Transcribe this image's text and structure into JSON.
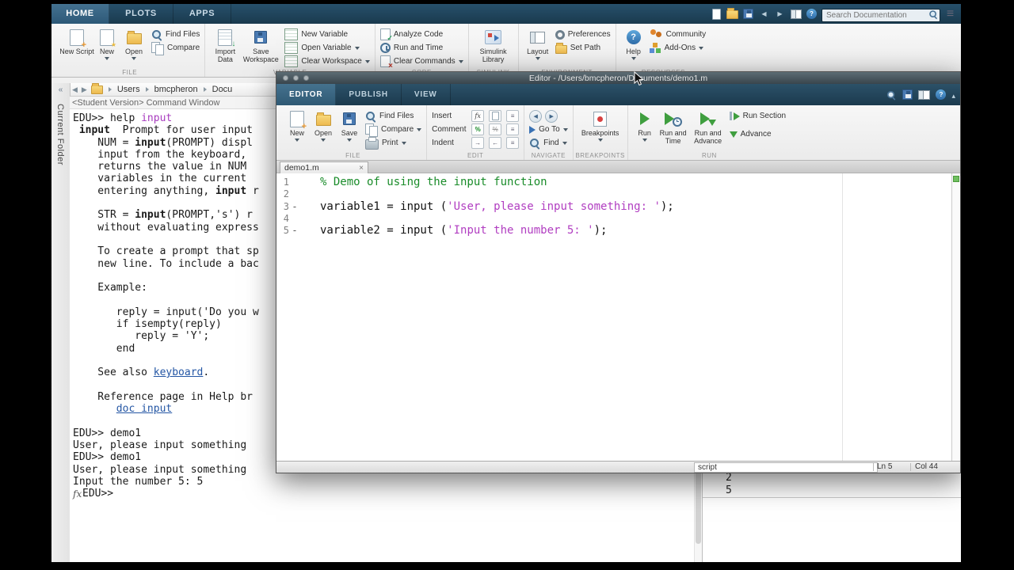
{
  "main_titlebar": {
    "tabs": [
      {
        "label": "HOME",
        "active": true
      },
      {
        "label": "PLOTS",
        "active": false
      },
      {
        "label": "APPS",
        "active": false
      }
    ],
    "search_placeholder": "Search Documentation"
  },
  "main_ribbon": {
    "new_script": "New Script",
    "new": "New",
    "open": "Open",
    "find_files": "Find Files",
    "compare": "Compare",
    "import_data": "Import Data",
    "save_workspace": "Save Workspace",
    "new_variable": "New Variable",
    "open_variable": "Open Variable",
    "clear_workspace": "Clear Workspace",
    "analyze_code": "Analyze Code",
    "run_and_time": "Run and Time",
    "clear_commands": "Clear Commands",
    "simulink_library": "Simulink Library",
    "layout": "Layout",
    "preferences": "Preferences",
    "set_path": "Set Path",
    "help": "Help",
    "community": "Community",
    "add_ons": "Add-Ons",
    "sections": {
      "file": "FILE",
      "variable": "VARIABLE",
      "code": "CODE",
      "simulink": "SIMULINK",
      "environment": "ENVIRONMENT",
      "resources": "RESOURCES"
    }
  },
  "browser_bar": {
    "path": [
      "Users",
      "bmcpheron",
      "Docu"
    ]
  },
  "sidebar": {
    "label": "Current Folder",
    "collapse_glyph": "«"
  },
  "command_window": {
    "title": "<Student Version> Command Window",
    "fx_label": "fx",
    "lines": [
      {
        "segs": [
          {
            "t": "EDU>> help "
          },
          {
            "t": "input",
            "c": "cmd"
          }
        ]
      },
      {
        "segs": [
          {
            "t": " "
          },
          {
            "t": "input",
            "c": "b"
          },
          {
            "t": "  Prompt for user input"
          }
        ]
      },
      {
        "segs": [
          {
            "t": "    NUM = "
          },
          {
            "t": "input",
            "c": "b"
          },
          {
            "t": "(PROMPT) displ"
          }
        ]
      },
      {
        "segs": [
          {
            "t": "    input from the keyboard,"
          }
        ]
      },
      {
        "segs": [
          {
            "t": "    returns the value in NUM"
          }
        ]
      },
      {
        "segs": [
          {
            "t": "    variables in the current"
          }
        ]
      },
      {
        "segs": [
          {
            "t": "    entering anything, "
          },
          {
            "t": "input",
            "c": "b"
          },
          {
            "t": " r"
          }
        ]
      },
      {
        "segs": []
      },
      {
        "segs": [
          {
            "t": "    STR = "
          },
          {
            "t": "input",
            "c": "b"
          },
          {
            "t": "(PROMPT,'s') r"
          }
        ]
      },
      {
        "segs": [
          {
            "t": "    without evaluating express"
          }
        ]
      },
      {
        "segs": []
      },
      {
        "segs": [
          {
            "t": "    To create a prompt that sp"
          }
        ]
      },
      {
        "segs": [
          {
            "t": "    new line. To include a bac"
          }
        ]
      },
      {
        "segs": []
      },
      {
        "segs": [
          {
            "t": "    Example:"
          }
        ]
      },
      {
        "segs": []
      },
      {
        "segs": [
          {
            "t": "       reply = input('Do you w"
          }
        ]
      },
      {
        "segs": [
          {
            "t": "       if isempty(reply)"
          }
        ]
      },
      {
        "segs": [
          {
            "t": "          reply = 'Y';"
          }
        ]
      },
      {
        "segs": [
          {
            "t": "       end"
          }
        ]
      },
      {
        "segs": []
      },
      {
        "segs": [
          {
            "t": "    See also "
          },
          {
            "t": "keyboard",
            "c": "link"
          },
          {
            "t": "."
          }
        ]
      },
      {
        "segs": []
      },
      {
        "segs": [
          {
            "t": "    Reference page in Help br"
          }
        ]
      },
      {
        "segs": [
          {
            "t": "       "
          },
          {
            "t": "doc input",
            "c": "link"
          }
        ]
      },
      {
        "segs": []
      },
      {
        "segs": [
          {
            "t": "EDU>> demo1"
          }
        ]
      },
      {
        "segs": [
          {
            "t": "User, please input something"
          }
        ]
      },
      {
        "segs": [
          {
            "t": "EDU>> demo1"
          }
        ]
      },
      {
        "segs": [
          {
            "t": "User, please input something"
          }
        ]
      },
      {
        "segs": [
          {
            "t": "Input the number 5: 5"
          }
        ]
      },
      {
        "fx": true,
        "segs": [
          {
            "t": "EDU>> "
          }
        ]
      }
    ]
  },
  "background_panel": {
    "lines": [
      "2",
      "5"
    ]
  },
  "editor": {
    "window_title": "Editor - /Users/bmcpheron/Documents/demo1.m",
    "tabs": [
      {
        "label": "EDITOR",
        "active": true
      },
      {
        "label": "PUBLISH",
        "active": false
      },
      {
        "label": "VIEW",
        "active": false
      }
    ],
    "ribbon": {
      "file": {
        "new": "New",
        "open": "Open",
        "save": "Save",
        "find_files": "Find Files",
        "compare": "Compare",
        "print": "Print"
      },
      "edit": {
        "insert": "Insert",
        "comment": "Comment",
        "indent": "Indent"
      },
      "navigate": {
        "go_to": "Go To",
        "find": "Find"
      },
      "breakpoints": {
        "label": "Breakpoints"
      },
      "run": {
        "run": "Run",
        "run_and_time": "Run and Time",
        "run_and_advance": "Run and Advance",
        "run_section": "Run Section",
        "advance": "Advance"
      },
      "sections": {
        "file": "FILE",
        "edit": "EDIT",
        "navigate": "NAVIGATE",
        "breakpoints": "BREAKPOINTS",
        "run": "RUN"
      }
    },
    "file_tab": {
      "name": "demo1.m"
    },
    "code": {
      "lines": [
        {
          "num": "1",
          "mark": false,
          "segs": [
            {
              "t": "% Demo of using the input function",
              "c": "comment"
            }
          ]
        },
        {
          "num": "2",
          "mark": false,
          "segs": []
        },
        {
          "num": "3",
          "mark": true,
          "segs": [
            {
              "t": "variable1 = input ("
            },
            {
              "t": "'User, please input something: '",
              "c": "str"
            },
            {
              "t": ");"
            }
          ]
        },
        {
          "num": "4",
          "mark": false,
          "segs": []
        },
        {
          "num": "5",
          "mark": true,
          "segs": [
            {
              "t": "variable2 = input ("
            },
            {
              "t": "'Input the number 5: '",
              "c": "str"
            },
            {
              "t": ");"
            }
          ]
        }
      ]
    },
    "status": {
      "type": "script",
      "line": "Ln 5",
      "col": "Col 44"
    }
  },
  "icons": {
    "search": "magnifier",
    "dropdown": "▾",
    "close": "×",
    "run": "green-triangle",
    "help": "question-circle",
    "folder": "yellow-folder",
    "breakpoint": "red-dot-page"
  }
}
